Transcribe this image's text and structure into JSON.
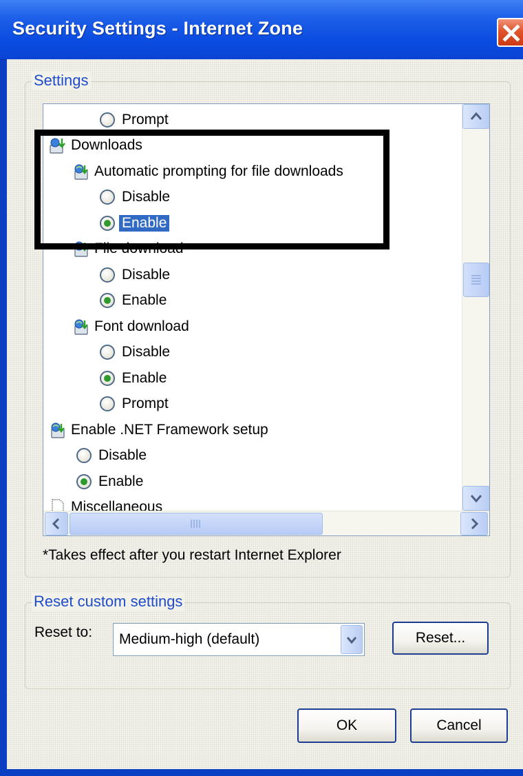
{
  "window": {
    "title": "Security Settings - Internet Zone"
  },
  "settings_group": {
    "label": "Settings",
    "tree": [
      {
        "type": "radio",
        "label": "Prompt",
        "checked": false,
        "indent": 2
      },
      {
        "type": "section",
        "label": "Downloads",
        "icon": "downloads-icon",
        "indent": 0
      },
      {
        "type": "setting",
        "label": "Automatic prompting for file downloads",
        "icon": "setting-icon",
        "indent": 1
      },
      {
        "type": "radio",
        "label": "Disable",
        "checked": false,
        "indent": 2
      },
      {
        "type": "radio",
        "label": "Enable",
        "checked": true,
        "selected": true,
        "indent": 2
      },
      {
        "type": "setting",
        "label": "File download",
        "icon": "setting-icon",
        "indent": 1
      },
      {
        "type": "radio",
        "label": "Disable",
        "checked": false,
        "indent": 2
      },
      {
        "type": "radio",
        "label": "Enable",
        "checked": true,
        "indent": 2
      },
      {
        "type": "setting",
        "label": "Font download",
        "icon": "setting-icon",
        "indent": 1
      },
      {
        "type": "radio",
        "label": "Disable",
        "checked": false,
        "indent": 2
      },
      {
        "type": "radio",
        "label": "Enable",
        "checked": true,
        "indent": 2
      },
      {
        "type": "radio",
        "label": "Prompt",
        "checked": false,
        "indent": 2
      },
      {
        "type": "setting",
        "label": "Enable .NET Framework setup",
        "icon": "setting-icon",
        "indent": 0
      },
      {
        "type": "radio",
        "label": "Disable",
        "checked": false,
        "indent": 1
      },
      {
        "type": "radio",
        "label": "Enable",
        "checked": true,
        "indent": 1
      },
      {
        "type": "section",
        "label": "Miscellaneous",
        "icon": "page-icon",
        "indent": 0
      }
    ],
    "note": "*Takes effect after you restart Internet Explorer"
  },
  "reset_group": {
    "label": "Reset custom settings",
    "reset_to_label": "Reset to:",
    "selected_level": "Medium-high (default)",
    "reset_button": "Reset..."
  },
  "footer": {
    "ok": "OK",
    "cancel": "Cancel"
  },
  "colors": {
    "title_bar": "#0a4be0",
    "selection": "#316ac5",
    "group_label": "#1f4cc8",
    "close_button": "#e0542c"
  }
}
